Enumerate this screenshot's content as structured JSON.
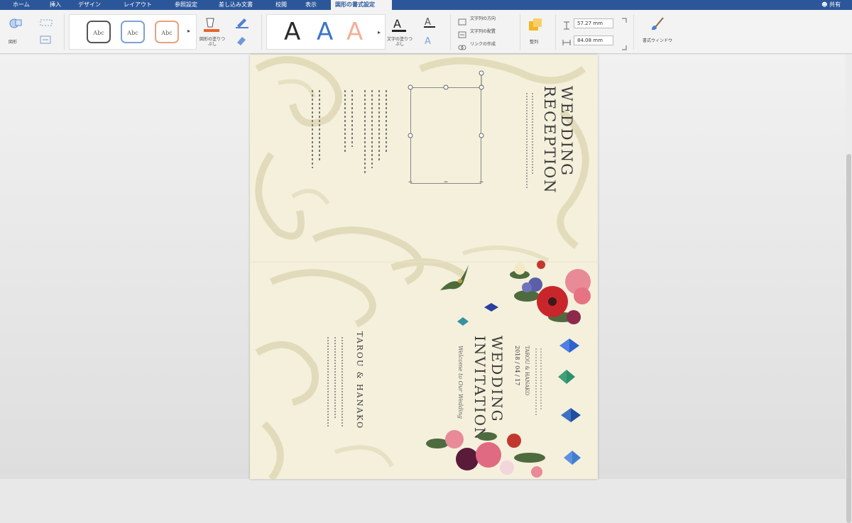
{
  "tabs": [
    "ホーム",
    "挿入",
    "デザイン",
    "レイアウト",
    "参照設定",
    "差し込み文書",
    "校閲",
    "表示",
    "図形の書式設定"
  ],
  "share_label": "共有",
  "ribbon": {
    "shape_label": "図形",
    "abc_label": "Abc",
    "fill_label": "図形の塗りつぶし",
    "text_fill_label": "文字の塗りつぶし",
    "text_direction_label": "文字列の方向",
    "text_align_label": "文字列の配置",
    "link_label": "リンクの作成",
    "arrange_label": "整列",
    "height_value": "57.27 mm",
    "width_value": "84.08 mm",
    "format_pane_label": "書式ウィンドウ",
    "bigA": "A"
  },
  "document": {
    "reception_title": "WEDDING RECEPTION",
    "invitation_title": "WEDDING INVITATION",
    "names": "TAROU & HANAKO",
    "date": "2018 / 04 / 17",
    "welcome": "Welcome to Our Wedding"
  },
  "colors": {
    "accent": "#2b579a",
    "ribbon": "#f3f3f3",
    "paper": "#f4f0dc"
  }
}
